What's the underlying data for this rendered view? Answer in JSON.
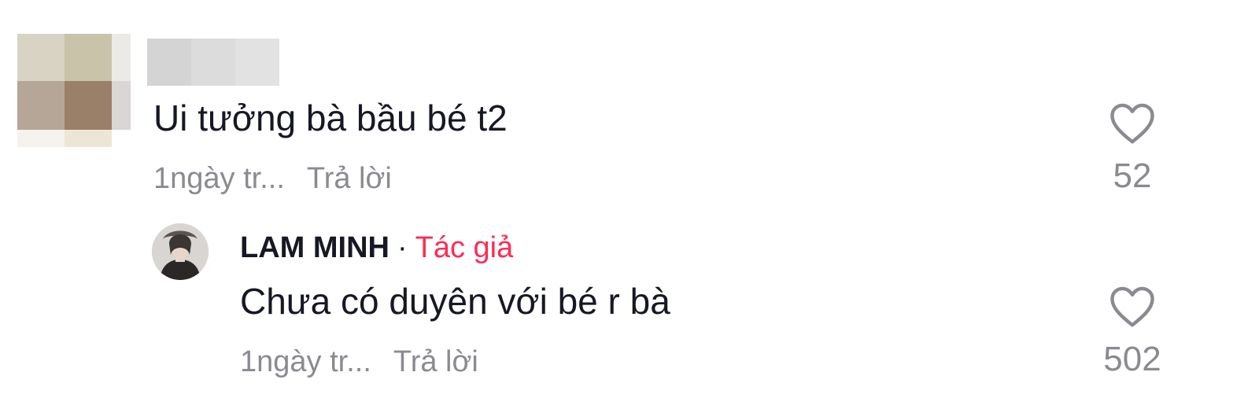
{
  "comments": [
    {
      "text": "Ui tưởng bà bầu bé t2",
      "time": "1ngày tr...",
      "reply_label": "Trả lời",
      "likes": "52",
      "icon": "heart-outline-icon"
    }
  ],
  "reply": {
    "author": "LAM MINH",
    "separator": "·",
    "badge": "Tác giả",
    "text": "Chưa có duyên với bé r bà",
    "time": "1ngày tr...",
    "reply_label": "Trả lời",
    "likes": "502",
    "icon": "heart-outline-icon"
  },
  "colors": {
    "text": "#161823",
    "secondary": "#8a8b91",
    "author_badge": "#fe2c55"
  }
}
